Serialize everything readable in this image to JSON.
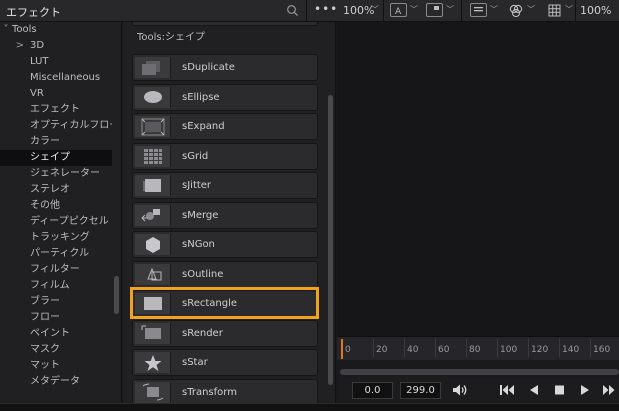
{
  "header": {
    "panel_title": "エフェクト",
    "zoom_left": "100%",
    "zoom_right": "100%"
  },
  "tree": {
    "root_label": "Tools",
    "items": [
      {
        "label": "3D",
        "expander": ">"
      },
      {
        "label": "LUT"
      },
      {
        "label": "Miscellaneous"
      },
      {
        "label": "VR"
      },
      {
        "label": "エフェクト"
      },
      {
        "label": "オプティカルフロー"
      },
      {
        "label": "カラー"
      },
      {
        "label": "シェイプ",
        "selected": true
      },
      {
        "label": "ジェネレーター"
      },
      {
        "label": "ステレオ"
      },
      {
        "label": "その他"
      },
      {
        "label": "ディープピクセル"
      },
      {
        "label": "トラッキング"
      },
      {
        "label": "パーティクル"
      },
      {
        "label": "フィルター"
      },
      {
        "label": "フィルム"
      },
      {
        "label": "ブラー"
      },
      {
        "label": "フロー"
      },
      {
        "label": "ペイント"
      },
      {
        "label": "マスク"
      },
      {
        "label": "マット"
      },
      {
        "label": "メタデータ"
      }
    ]
  },
  "list": {
    "breadcrumb": "Tools:シェイプ",
    "tools": [
      {
        "label": "sDuplicate",
        "icon": "duplicate-icon"
      },
      {
        "label": "sEllipse",
        "icon": "ellipse-icon"
      },
      {
        "label": "sExpand",
        "icon": "expand-icon"
      },
      {
        "label": "sGrid",
        "icon": "grid-icon"
      },
      {
        "label": "sJitter",
        "icon": "jitter-icon"
      },
      {
        "label": "sMerge",
        "icon": "merge-icon"
      },
      {
        "label": "sNGon",
        "icon": "ngon-icon"
      },
      {
        "label": "sOutline",
        "icon": "outline-icon"
      },
      {
        "label": "sRectangle",
        "icon": "rectangle-icon",
        "highlighted": true
      },
      {
        "label": "sRender",
        "icon": "render-icon"
      },
      {
        "label": "sStar",
        "icon": "star-icon"
      },
      {
        "label": "sTransform",
        "icon": "transform-icon"
      }
    ]
  },
  "timeline": {
    "ticks": [
      "0",
      "20",
      "40",
      "60",
      "80",
      "100",
      "120",
      "140",
      "160"
    ]
  },
  "transport": {
    "current_frame": "0.0",
    "end_frame": "299.0"
  },
  "colors": {
    "highlight": "#f3a21b",
    "playhead": "#e2781e",
    "panel_bg": "#202022"
  }
}
